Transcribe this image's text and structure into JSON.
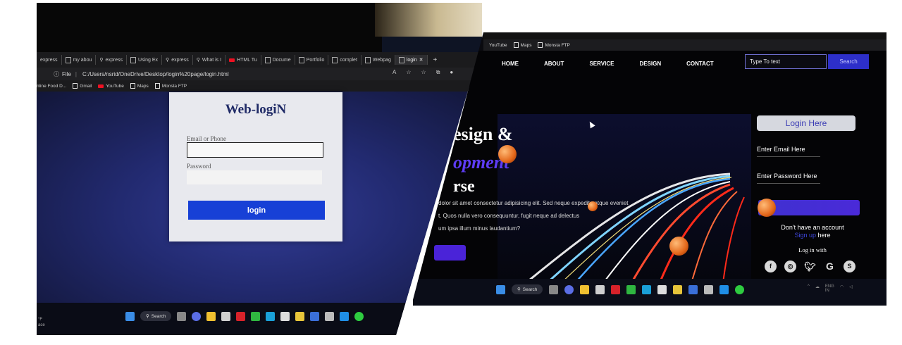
{
  "left": {
    "tabs": [
      {
        "label": "express"
      },
      {
        "label": "my abou"
      },
      {
        "label": "express"
      },
      {
        "label": "Using Ex"
      },
      {
        "label": "express"
      },
      {
        "label": "What is I"
      },
      {
        "label": "HTML Tu"
      },
      {
        "label": "Docume"
      },
      {
        "label": "Portfolio"
      },
      {
        "label": "complet"
      },
      {
        "label": "Webpag"
      },
      {
        "label": "login",
        "active": true
      }
    ],
    "address": {
      "label": "File",
      "url": "C:/Users/nsrid/OneDrive/Desktop/login%20page/login.html"
    },
    "bookmarks": [
      "nline Food D...",
      "Gmail",
      "YouTube",
      "Maps",
      "Monsta FTP"
    ],
    "card": {
      "title": "Web-logiN",
      "email_label": "Email or Phone",
      "password_label": "Password",
      "login_button": "login"
    },
    "taskbar": {
      "search": "Search",
      "weather_top": "°F",
      "weather_bottom": "ace"
    }
  },
  "right": {
    "bookmarks": [
      "YouTube",
      "Maps",
      "Monsta FTP"
    ],
    "nav": [
      "HOME",
      "ABOUT",
      "SERVICE",
      "DESIGN",
      "CONTACT"
    ],
    "search": {
      "placeholder": "Type To text",
      "button": "Search"
    },
    "hero": {
      "line1": "esign &",
      "line2": "opment",
      "line3": "rse",
      "p1": "dolor sit amet consectetur adipisicing elit. Sed neque expedita atque eveniet",
      "p2": "t. Quos nulla vero consequuntur, fugit neque ad delectus",
      "p3": "um ipsa illum minus laudantium?"
    },
    "panel": {
      "login_here": "Login Here",
      "email": "Enter Email Here",
      "password": "Enter Password Here",
      "no_account": "Don't have an account",
      "sign_up": "Sign up",
      "here": "here",
      "login_with": "Log in with",
      "socials": [
        "facebook",
        "instagram",
        "twitter",
        "google",
        "skype"
      ]
    },
    "taskbar": {
      "search": "Search",
      "lang": "ENG",
      "region": "IN"
    },
    "colors": {
      "accent": "#4a2ad8",
      "link": "#3f48e0"
    }
  }
}
